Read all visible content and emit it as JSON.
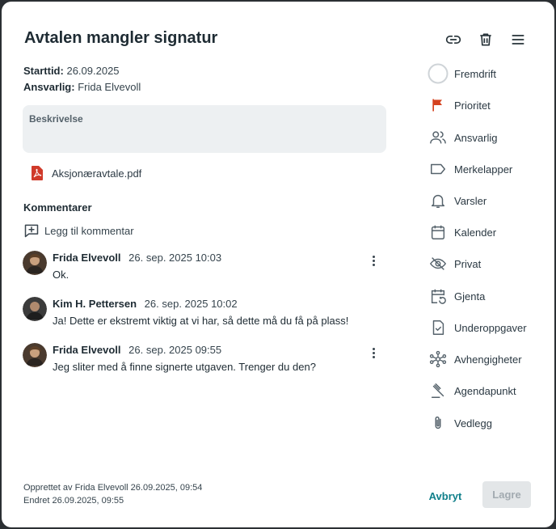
{
  "task": {
    "title": "Avtalen mangler signatur",
    "start_label": "Starttid:",
    "start_value": "26.09.2025",
    "owner_label": "Ansvarlig:",
    "owner_value": "Frida Elvevoll",
    "description_label": "Beskrivelse",
    "attachment": "Aksjonæravtale.pdf"
  },
  "toolbar_icons": [
    "link-icon",
    "trash-icon",
    "menu-icon"
  ],
  "comments": {
    "heading": "Kommentarer",
    "add_label": "Legg til kommentar",
    "items": [
      {
        "author": "Frida Elvevoll",
        "time": "26. sep. 2025 10:03",
        "text": "Ok.",
        "has_menu": true
      },
      {
        "author": "Kim H. Pettersen",
        "time": "26. sep. 2025 10:02",
        "text": "Ja! Dette er ekstremt viktig at vi har, så dette må du få på plass!",
        "has_menu": false
      },
      {
        "author": "Frida Elvevoll",
        "time": "26. sep. 2025 09:55",
        "text": "Jeg sliter med å finne signerte utgaven. Trenger du den?",
        "has_menu": true
      }
    ]
  },
  "sidebar": {
    "items": [
      {
        "label": "Fremdrift",
        "icon": "progress-circle-icon"
      },
      {
        "label": "Prioritet",
        "icon": "flag-icon"
      },
      {
        "label": "Ansvarlig",
        "icon": "people-icon"
      },
      {
        "label": "Merkelapper",
        "icon": "tag-icon"
      },
      {
        "label": "Varsler",
        "icon": "bell-icon"
      },
      {
        "label": "Kalender",
        "icon": "calendar-icon"
      },
      {
        "label": "Privat",
        "icon": "eye-off-icon"
      },
      {
        "label": "Gjenta",
        "icon": "calendar-repeat-icon"
      },
      {
        "label": "Underoppgaver",
        "icon": "checklist-icon"
      },
      {
        "label": "Avhengigheter",
        "icon": "network-icon"
      },
      {
        "label": "Agendapunkt",
        "icon": "gavel-icon"
      },
      {
        "label": "Vedlegg",
        "icon": "paperclip-icon"
      }
    ]
  },
  "footer": {
    "created": "Opprettet av Frida Elvevoll 26.09.2025, 09:54",
    "modified": "Endret 26.09.2025, 09:55",
    "cancel_label": "Avbryt",
    "save_label": "Lagre"
  },
  "colors": {
    "accent": "#0f7f8a",
    "priority_flag": "#d4421f",
    "pdf_icon": "#d03a2a",
    "description_bg": "#edf0f2"
  }
}
